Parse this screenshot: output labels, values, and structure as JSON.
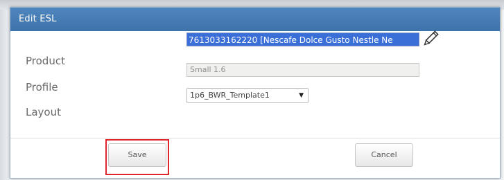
{
  "dialog": {
    "title": "Edit ESL"
  },
  "form": {
    "product": {
      "label": "Product",
      "value": "7613033162220 [Nescafe Dolce Gusto Nestle Ne"
    },
    "profile": {
      "label": "Profile",
      "value": "Small 1.6"
    },
    "layout": {
      "label": "Layout",
      "selected": "1p6_BWR_Template1"
    }
  },
  "buttons": {
    "save_label": "Save",
    "cancel_label": "Cancel"
  },
  "icons": {
    "edit_product": "pencil-icon",
    "dropdown": "caret-down-icon"
  },
  "colors": {
    "titlebar": "#3f77af",
    "selection": "#3b6fd8",
    "highlight_box": "#e0262b"
  }
}
